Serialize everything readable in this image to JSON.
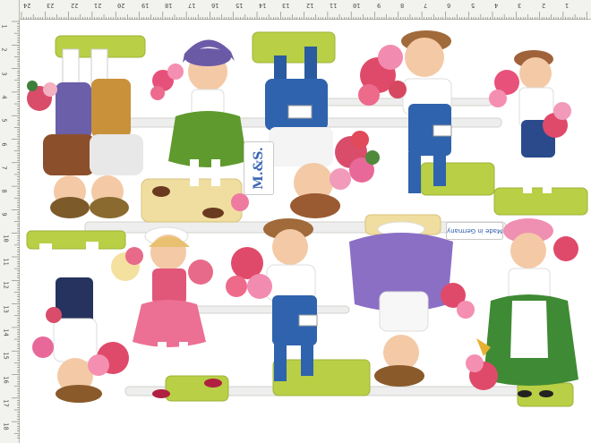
{
  "ruler_top": {
    "labels": [
      "24",
      "23",
      "22",
      "21",
      "20",
      "19",
      "18",
      "17",
      "16",
      "15",
      "14",
      "13",
      "12",
      "11",
      "10",
      "9",
      "8",
      "7",
      "6",
      "5",
      "4",
      "3",
      "2",
      "1"
    ]
  },
  "ruler_left": {
    "labels": [
      "1",
      "2",
      "3",
      "4",
      "5",
      "6",
      "7",
      "8",
      "9",
      "10",
      "11",
      "12",
      "13",
      "14",
      "15",
      "16",
      "17",
      "18"
    ]
  },
  "sheet": {
    "label_publisher": "M.&S.",
    "label_origin": "Made in Germany"
  },
  "colors": {
    "grass": "#b9cf45",
    "ribbon": "#eeeeee",
    "shadow": "#d8d8d2"
  }
}
